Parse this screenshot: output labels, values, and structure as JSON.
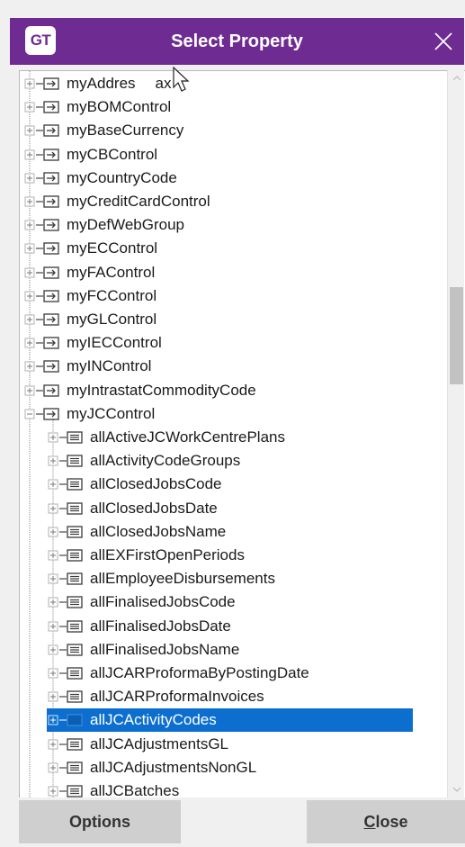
{
  "window": {
    "logo_text": "GT",
    "title": "Select Property",
    "close_icon": "close-icon"
  },
  "tree": {
    "top_items": [
      {
        "label": "myAddressTax",
        "display": "myAddres",
        "display_tail": "ax",
        "expanded": false
      },
      {
        "label": "myBOMControl",
        "expanded": false
      },
      {
        "label": "myBaseCurrency",
        "expanded": false
      },
      {
        "label": "myCBControl",
        "expanded": false
      },
      {
        "label": "myCountryCode",
        "expanded": false
      },
      {
        "label": "myCreditCardControl",
        "expanded": false
      },
      {
        "label": "myDefWebGroup",
        "expanded": false
      },
      {
        "label": "myECControl",
        "expanded": false
      },
      {
        "label": "myFAControl",
        "expanded": false
      },
      {
        "label": "myFCControl",
        "expanded": false
      },
      {
        "label": "myGLControl",
        "expanded": false
      },
      {
        "label": "myIECControl",
        "expanded": false
      },
      {
        "label": "myINControl",
        "expanded": false
      },
      {
        "label": "myIntrastatCommodityCode",
        "expanded": false
      },
      {
        "label": "myJCControl",
        "expanded": true
      }
    ],
    "children": [
      {
        "label": "allActiveJCWorkCentrePlans"
      },
      {
        "label": "allActivityCodeGroups"
      },
      {
        "label": "allClosedJobsCode"
      },
      {
        "label": "allClosedJobsDate"
      },
      {
        "label": "allClosedJobsName"
      },
      {
        "label": "allEXFirstOpenPeriods"
      },
      {
        "label": "allEmployeeDisbursements"
      },
      {
        "label": "allFinalisedJobsCode"
      },
      {
        "label": "allFinalisedJobsDate"
      },
      {
        "label": "allFinalisedJobsName"
      },
      {
        "label": "allJCARProformaByPostingDate"
      },
      {
        "label": "allJCARProformaInvoices"
      },
      {
        "label": "allJCActivityCodes",
        "selected": true
      },
      {
        "label": "allJCAdjustmentsGL"
      },
      {
        "label": "allJCAdjustmentsNonGL"
      },
      {
        "label": "allJCBatches"
      }
    ]
  },
  "scrollbar": {
    "thumb_fraction_start": 0.3,
    "thumb_fraction_size": 0.14
  },
  "buttons": {
    "options": "Options",
    "close": "Close"
  },
  "colors": {
    "titlebar": "#6e2b92",
    "selection": "#0c6fcf",
    "button": "#cfcfcf"
  },
  "icons": {
    "property_icon": "property-icon",
    "collection_icon": "collection-icon",
    "expand_icon": "expand-plus-icon",
    "collapse_icon": "collapse-minus-icon"
  }
}
